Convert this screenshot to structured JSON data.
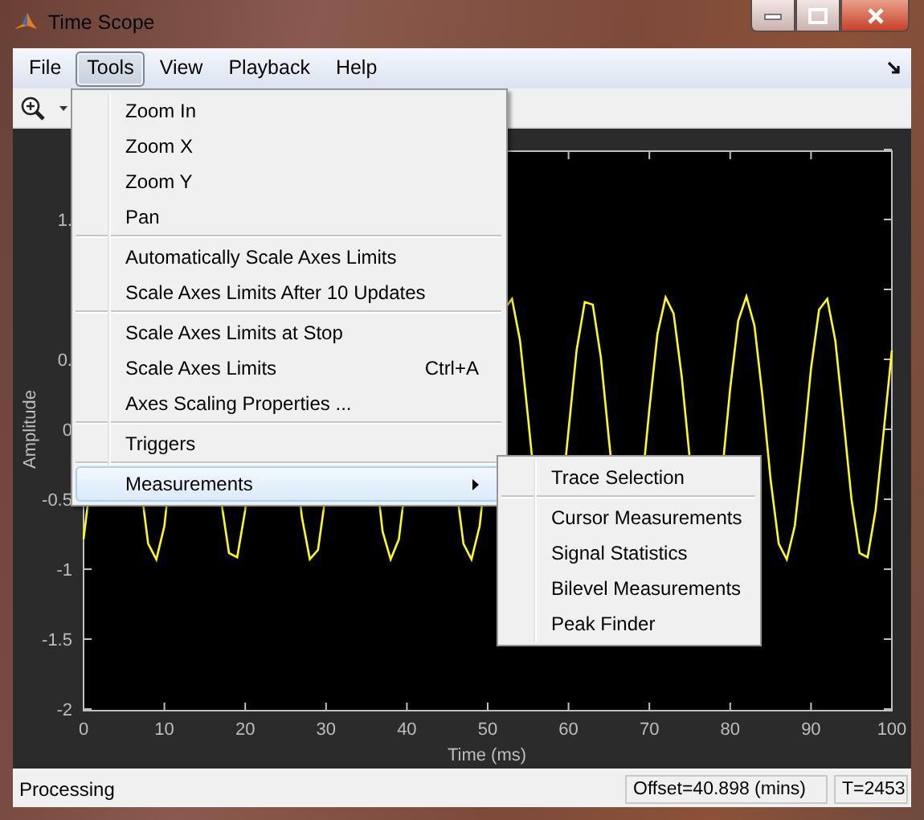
{
  "window": {
    "title": "Time Scope"
  },
  "menubar": [
    {
      "label": "File",
      "selected": false
    },
    {
      "label": "Tools",
      "selected": true
    },
    {
      "label": "View",
      "selected": false
    },
    {
      "label": "Playback",
      "selected": false
    },
    {
      "label": "Help",
      "selected": false
    }
  ],
  "tools_menu": {
    "groups": [
      {
        "items": [
          {
            "label": "Zoom In",
            "selected": false
          },
          {
            "label": "Zoom X",
            "selected": false
          },
          {
            "label": "Zoom Y",
            "selected": false
          },
          {
            "label": "Pan",
            "selected": false
          }
        ]
      },
      {
        "items": [
          {
            "label": "Automatically Scale Axes Limits",
            "selected": false
          },
          {
            "label": "Scale Axes Limits After 10 Updates",
            "selected": false
          }
        ]
      },
      {
        "items": [
          {
            "label": "Scale Axes Limits at Stop",
            "selected": false
          },
          {
            "label": "Scale Axes Limits",
            "shortcut": "Ctrl+A",
            "selected": false
          },
          {
            "label": "Axes Scaling Properties ...",
            "selected": false
          }
        ]
      },
      {
        "items": [
          {
            "label": "Triggers",
            "selected": false
          }
        ]
      },
      {
        "items": [
          {
            "label": "Measurements",
            "selected": true,
            "submenu": true
          }
        ]
      }
    ]
  },
  "measurements_submenu": {
    "groups": [
      {
        "items": [
          {
            "label": "Trace Selection",
            "selected": false
          }
        ]
      },
      {
        "items": [
          {
            "label": "Cursor Measurements",
            "selected": false
          },
          {
            "label": "Signal Statistics",
            "selected": false
          },
          {
            "label": "Bilevel Measurements",
            "selected": false
          },
          {
            "label": "Peak Finder",
            "selected": false
          }
        ]
      }
    ]
  },
  "plot": {
    "ylabel": "Amplitude",
    "xlabel": "Time (ms)",
    "yticks": [
      "1.",
      "0.",
      "0",
      "-0.5",
      "-1",
      "-1.5",
      "-2"
    ],
    "xticks": [
      "0",
      "10",
      "20",
      "30",
      "40",
      "50",
      "60",
      "70",
      "80",
      "90",
      "100"
    ]
  },
  "status_bar": {
    "message": "Processing",
    "offset": "Offset=40.898 (mins)",
    "time": "T=2453"
  }
}
